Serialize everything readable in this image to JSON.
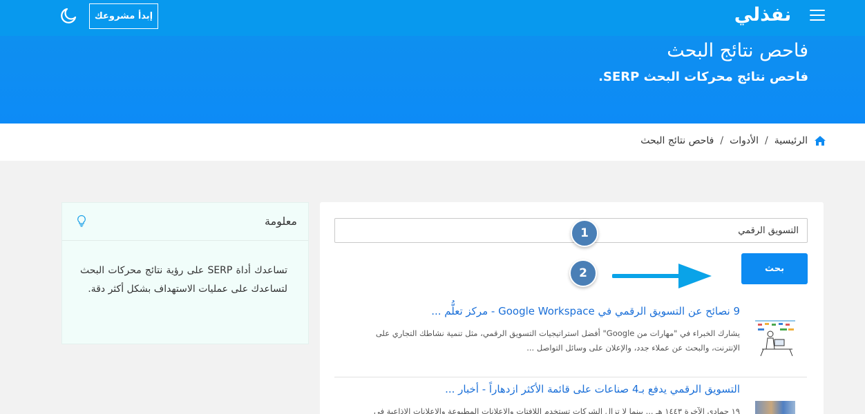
{
  "header": {
    "logo": "نفذلي",
    "start_button": "إبدأ مشروعك",
    "title": "فاحص نتائج البحث",
    "subtitle": "فاحص نتائج محركات البحث SERP."
  },
  "breadcrumb": {
    "home": "الرئيسية",
    "tools": "الأدوات",
    "current": "فاحص نتائج البحث",
    "separator": "/"
  },
  "search": {
    "value": "التسويق الرقمي",
    "button": "بحث"
  },
  "steps": [
    "1",
    "2"
  ],
  "results": [
    {
      "title": "9 نصائح عن التسويق الرقمي في Google Workspace - مركز تعلُّم ...",
      "description": "يشارك الخبراء في \"مهارات من Google\" أفضل استراتيجيات التسويق الرقمي، مثل تنمية نشاطك التجاري على الإنترنت، والبحث عن عملاء جدد، والإعلان على وسائل التواصل ..."
    },
    {
      "title": "التسويق الرقمي يدفع بـ4 صناعات على قائمة الأكثر ازدهاراً - أخبار ...",
      "description": "١٩ جمادى الآخرة ١٤٤٣ هـ ... بينما لا تزال الشركات تستخدم اللافتات والإعلانات المطبوعة والإعلانات الإذاعية في"
    }
  ],
  "info": {
    "title": "معلومة",
    "text": "تساعدك أداة SERP على رؤية نتائج محركات البحث لتساعدك على عمليات الاستهداف بشكل أكثر دقة."
  },
  "colors": {
    "header_blue": "#0d8bf7",
    "link_blue": "#1a6fd8",
    "button_blue": "#0d8bf2",
    "badge_blue": "#4a7fb6",
    "arrow_blue": "#0aa3e8",
    "info_bg": "#f1fdfa"
  }
}
